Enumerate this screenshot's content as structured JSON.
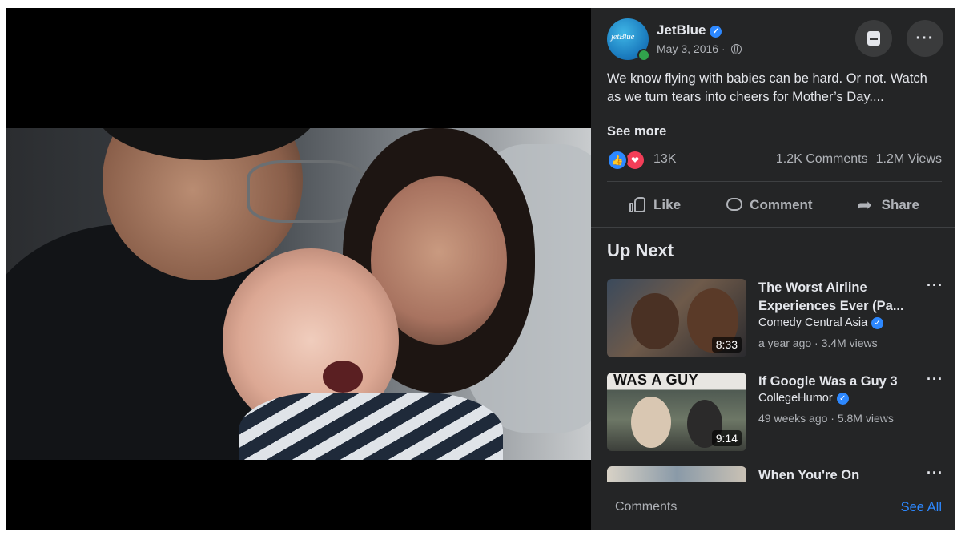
{
  "post": {
    "page_name": "JetBlue",
    "avatar_text": "jetBlue",
    "date": "May 3, 2016 ·",
    "text": "We know flying with babies can be hard. Or not. Watch as we turn tears into cheers for Mother’s Day....",
    "see_more": "See more",
    "reaction_count": "13K",
    "comments_count": "1.2K Comments",
    "views_count": "1.2M Views"
  },
  "actions": {
    "like": "Like",
    "comment": "Comment",
    "share": "Share"
  },
  "icons": {
    "verified": "verified-badge-icon",
    "globe": "globe-icon",
    "save": "save-bookmark-icon",
    "more": "more-options-icon",
    "like_reaction": "like-reaction-icon",
    "love_reaction": "love-reaction-icon"
  },
  "more_glyph": "···",
  "up_next": {
    "title": "Up Next",
    "items": [
      {
        "title": "The Worst Airline Experiences Ever (Pa...",
        "channel": "Comedy Central Asia",
        "meta": "a year ago · 3.4M views",
        "duration": "8:33"
      },
      {
        "title": "If Google Was a Guy 3",
        "channel": "CollegeHumor",
        "meta": "49 weeks ago · 5.8M views",
        "duration": "9:14",
        "thumb_banner": "WAS A GUY"
      },
      {
        "title": "When You're On"
      }
    ]
  },
  "footer": {
    "comments": "Comments",
    "see_all": "See All"
  },
  "colors": {
    "panel_bg": "#242526",
    "accent": "#2d88ff",
    "love": "#f33e58",
    "text_secondary": "#b0b3b8"
  }
}
